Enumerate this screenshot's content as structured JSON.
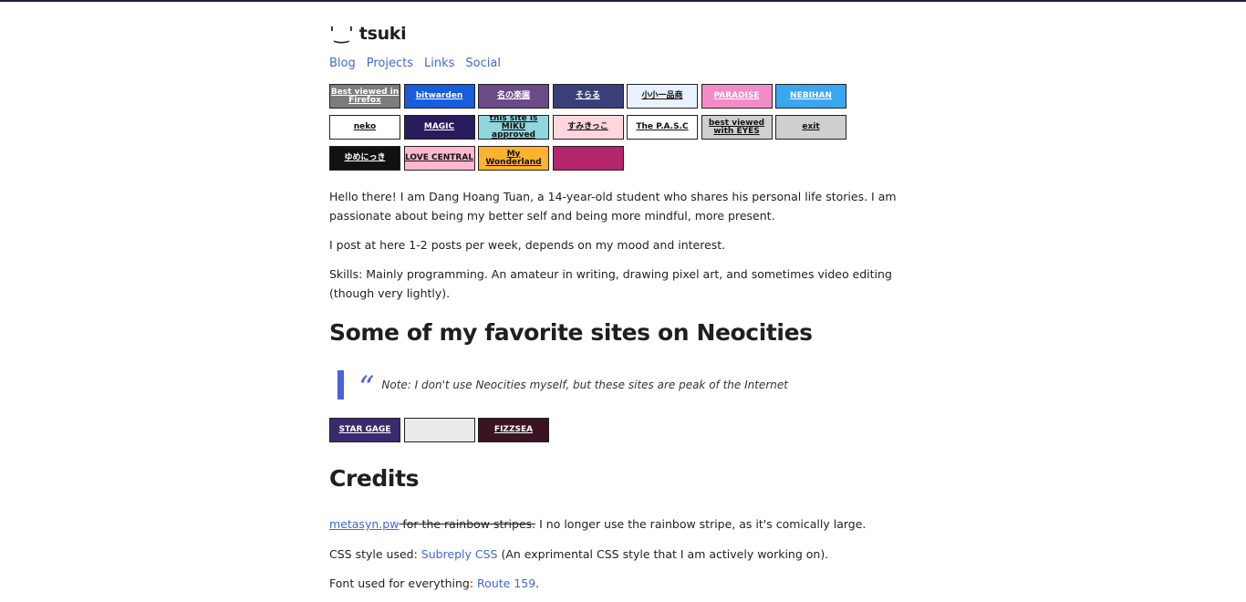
{
  "site": {
    "title": "ˈ‿ˈ tsuki"
  },
  "nav": [
    {
      "label": "Blog"
    },
    {
      "label": "Projects"
    },
    {
      "label": "Links"
    },
    {
      "label": "Social"
    }
  ],
  "buttons": [
    {
      "label": "Best viewed in Firefox",
      "name": "firefox-button",
      "color": "#7d7d7d"
    },
    {
      "label": "bitwarden",
      "name": "bitwarden-button",
      "color": "#175ddc"
    },
    {
      "label": "名の楽園",
      "name": "button-3",
      "color": "#6b4a8a"
    },
    {
      "label": "そらる",
      "name": "button-4",
      "color": "#3a3f7a"
    },
    {
      "label": "小小一品商",
      "name": "button-5",
      "color": "#e8f2ff"
    },
    {
      "label": "PARADISE",
      "name": "button-6",
      "color": "#f28bc7"
    },
    {
      "label": "NEBIHAN",
      "name": "button-7",
      "color": "#3aa6f0"
    },
    {
      "label": "neko",
      "name": "button-8",
      "color": "#ffffff"
    },
    {
      "label": "MAGIC",
      "name": "magic-button",
      "color": "#2a1a5e"
    },
    {
      "label": "this site is MIKU approved",
      "name": "miku-button",
      "color": "#8fd6dd"
    },
    {
      "label": "すみきっこ",
      "name": "button-11",
      "color": "#ffd5de"
    },
    {
      "label": "The P.A.S.C",
      "name": "pasc-button",
      "color": "#ffffff"
    },
    {
      "label": "best viewed with EYES",
      "name": "eyes-button",
      "color": "#cfcfcf"
    },
    {
      "label": "exit",
      "name": "exit-button",
      "color": "#cfcfcf"
    },
    {
      "label": "ゆめにっき",
      "name": "yume-nikki-button",
      "color": "#111111"
    },
    {
      "label": "LOVE CENTRAL",
      "name": "love-central-button",
      "color": "#ffb8cc"
    },
    {
      "label": "My Wonderland",
      "name": "my-wonderland-button",
      "color": "#ffb22f"
    },
    {
      "label": "",
      "name": "night-sky-button",
      "color": "#b5256b"
    }
  ],
  "intro": {
    "p1": "Hello there! I am Dang Hoang Tuan, a 14-year-old student who shares his personal life stories. I am passionate about being my better self and being more mindful, more present.",
    "p2": "I post at here 1-2 posts per week, depends on my mood and interest.",
    "p3": "Skills: Mainly programming. An amateur in writing, drawing pixel art, and sometimes video editing (though very lightly)."
  },
  "favorites": {
    "heading": "Some of my favorite sites on Neocities",
    "quote_mark": "“",
    "quote": "Note: I don't use Neocities myself, but these sites are peak of the Internet",
    "buttons": [
      {
        "label": "STAR GAGE",
        "name": "stargage-button",
        "color": "#3b2a6e"
      },
      {
        "label": "",
        "name": "faces-button",
        "color": "#eaeaea"
      },
      {
        "label": "FIZZSEA",
        "name": "fizzsea-button",
        "color": "#3b1424"
      }
    ]
  },
  "credits": {
    "heading": "Credits",
    "c1_link": "metasyn.pw",
    "c1_strike": " for the rainbow stripes.",
    "c1_rest": " I no longer use the rainbow stripe, as it's comically large.",
    "c2_prefix": "CSS style used: ",
    "c2_link": "Subreply CSS",
    "c2_rest": " (An exprimental CSS style that I am actively working on).",
    "c3_prefix": "Font used for everything: ",
    "c3_link": "Route 159",
    "c3_rest": "."
  }
}
